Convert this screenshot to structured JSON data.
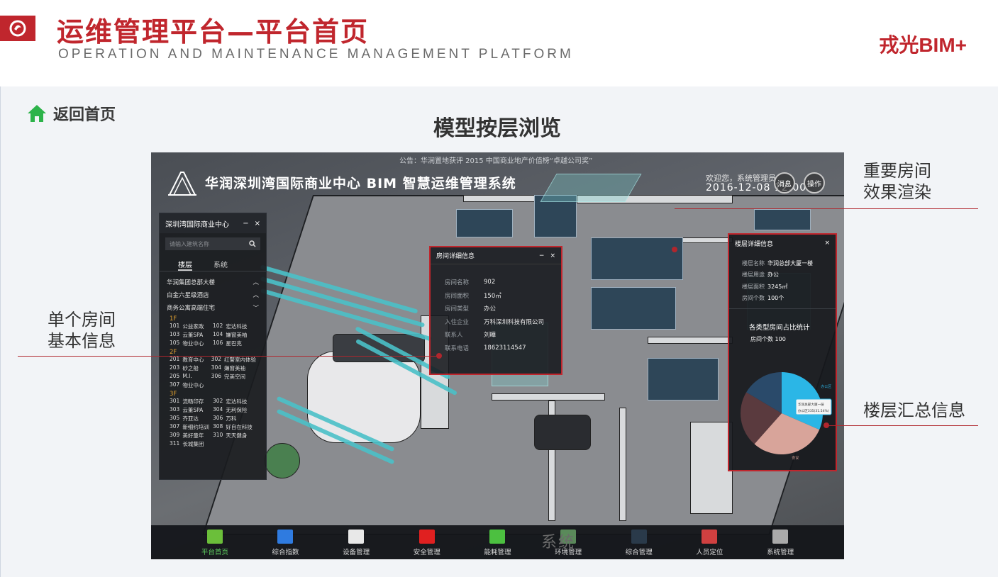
{
  "header": {
    "title": "运维管理平台—平台首页",
    "subtitle": "OPERATION AND MAINTENANCE MANAGEMENT PLATFORM",
    "brand": "戎光BIM+",
    "logo_icon": "brand-logo-icon"
  },
  "nav": {
    "back_label": "返回首页",
    "back_icon": "home-icon"
  },
  "section_title": "模型按层浏览",
  "app": {
    "notice": "公告：华润置地获评 2015 中国商业地产价值榜“卓越公司奖”",
    "system_title": "华润深圳湾国际商业中心 BIM 智慧运维管理系统",
    "welcome": "欢迎您，系统管理员",
    "datetime": "2016-12-08 12:00",
    "message_label": "消息",
    "operate_label": "操作",
    "left_panel": {
      "title": "深圳湾国际商业中心",
      "search_placeholder": "请输入建筑名称",
      "tabs": [
        "楼层",
        "系统"
      ],
      "buildings": [
        "华润集团总部大楼",
        "白金六星级酒店",
        "商务公寓高端住宅"
      ],
      "floors": [
        {
          "name": "1F",
          "rooms": [
            {
              "no": "101",
              "name": "公益家政"
            },
            {
              "no": "102",
              "name": "宏达科技"
            },
            {
              "no": "103",
              "name": "云董SPA"
            },
            {
              "no": "104",
              "name": "嫌窗美袖"
            },
            {
              "no": "105",
              "name": "物业中心"
            },
            {
              "no": "106",
              "name": "星巴克"
            }
          ]
        },
        {
          "name": "2F",
          "rooms": [
            {
              "no": "201",
              "name": "教育中心"
            },
            {
              "no": "302",
              "name": "红警室内体验"
            },
            {
              "no": "203",
              "name": "砂之船"
            },
            {
              "no": "304",
              "name": "嫌窗美袖"
            },
            {
              "no": "205",
              "name": "M.I."
            },
            {
              "no": "306",
              "name": "完美空间"
            },
            {
              "no": "307",
              "name": "物业中心"
            }
          ]
        },
        {
          "name": "3F",
          "rooms": [
            {
              "no": "301",
              "name": "流畅印存"
            },
            {
              "no": "302",
              "name": "宏达科技"
            },
            {
              "no": "303",
              "name": "云董SPA"
            },
            {
              "no": "304",
              "name": "无利保险"
            },
            {
              "no": "305",
              "name": "齐亚达"
            },
            {
              "no": "306",
              "name": "万科"
            },
            {
              "no": "307",
              "name": "新细约培训"
            },
            {
              "no": "308",
              "name": "好自在科技"
            },
            {
              "no": "309",
              "name": "美好童年"
            },
            {
              "no": "310",
              "name": "天天健身"
            },
            {
              "no": "311",
              "name": "长城集团"
            }
          ]
        }
      ]
    },
    "room_panel": {
      "title": "房间详细信息",
      "rows": [
        {
          "k": "房间名称",
          "v": "902"
        },
        {
          "k": "房间面积",
          "v": "150㎡"
        },
        {
          "k": "房间类型",
          "v": "办公"
        },
        {
          "k": "入住企业",
          "v": "万科深圳科技有限公司"
        },
        {
          "k": "联系人",
          "v": "刘曄"
        },
        {
          "k": "联系电话",
          "v": "18623114547"
        }
      ]
    },
    "floor_panel": {
      "title": "楼层详细信息",
      "rows": [
        {
          "k": "楼层名称",
          "v": "华润总部大厦一楼"
        },
        {
          "k": "楼层用途",
          "v": "办公"
        },
        {
          "k": "楼层面积",
          "v": "3245㎡"
        },
        {
          "k": "房间个数",
          "v": "100个"
        }
      ],
      "stat_title": "各类型房间占比统计",
      "room_count_label": "房间个数",
      "room_count": "100",
      "tooltip_line1": "华润总部大厦一层",
      "tooltip_line2": "办公区335(31.54%)"
    },
    "bottom_nav": [
      {
        "label": "平台首页",
        "icon": "platform-home-icon",
        "color": "#6bbf3a",
        "active": true
      },
      {
        "label": "综合指数",
        "icon": "index-chart-icon",
        "color": "#2f7be0",
        "active": false
      },
      {
        "label": "设备管理",
        "icon": "device-icon",
        "color": "#e8e8e8",
        "active": false
      },
      {
        "label": "安全管理",
        "icon": "alarm-icon",
        "color": "#e02020",
        "active": false
      },
      {
        "label": "能耗管理",
        "icon": "battery-icon",
        "color": "#4cc040",
        "active": false
      },
      {
        "label": "环境管理",
        "icon": "environment-icon",
        "color": "#5a8a5a",
        "active": false
      },
      {
        "label": "综合管理",
        "icon": "monitor-icon",
        "color": "#2a3a4a",
        "active": false
      },
      {
        "label": "人员定位",
        "icon": "map-pin-icon",
        "color": "#d04040",
        "active": false
      },
      {
        "label": "系统管理",
        "icon": "system-gear-icon",
        "color": "#aaaaaa",
        "active": false
      }
    ],
    "ghost_text": "系统"
  },
  "callouts": {
    "important_room": [
      "重要房间",
      "效果渲染"
    ],
    "single_room": [
      "单个房间",
      "基本信息"
    ],
    "floor_summary": "楼层汇总信息"
  },
  "chart_data": {
    "type": "pie",
    "title": "各类型房间占比统计",
    "slices": [
      {
        "name": "办公区",
        "value": 31.54,
        "color": "#2bb6e6"
      },
      {
        "name": "会议",
        "value": 30,
        "color": "#d8a49a"
      },
      {
        "name": "",
        "value": 22,
        "color": "#5a3a3e"
      },
      {
        "name": "",
        "value": 16.46,
        "color": "#2a4a6a"
      }
    ]
  }
}
